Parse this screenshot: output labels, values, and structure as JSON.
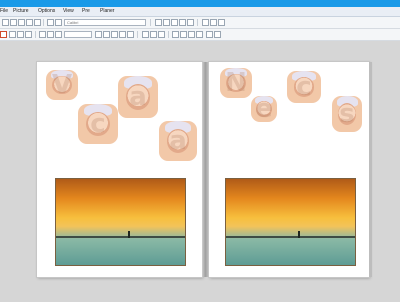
{
  "menu": [
    "File",
    "Picture",
    "Options",
    "View",
    "Pre",
    "Planer"
  ],
  "toolbar": {
    "font_combo": "Calibri",
    "size_combo": ""
  },
  "left_page": {
    "letters": [
      "V",
      "a",
      "c",
      "a"
    ],
    "photo_alt": "sunset beach photo"
  },
  "right_page": {
    "letters": [
      "N",
      "c",
      "e",
      "s"
    ],
    "photo_alt": "sunset beach photo"
  }
}
